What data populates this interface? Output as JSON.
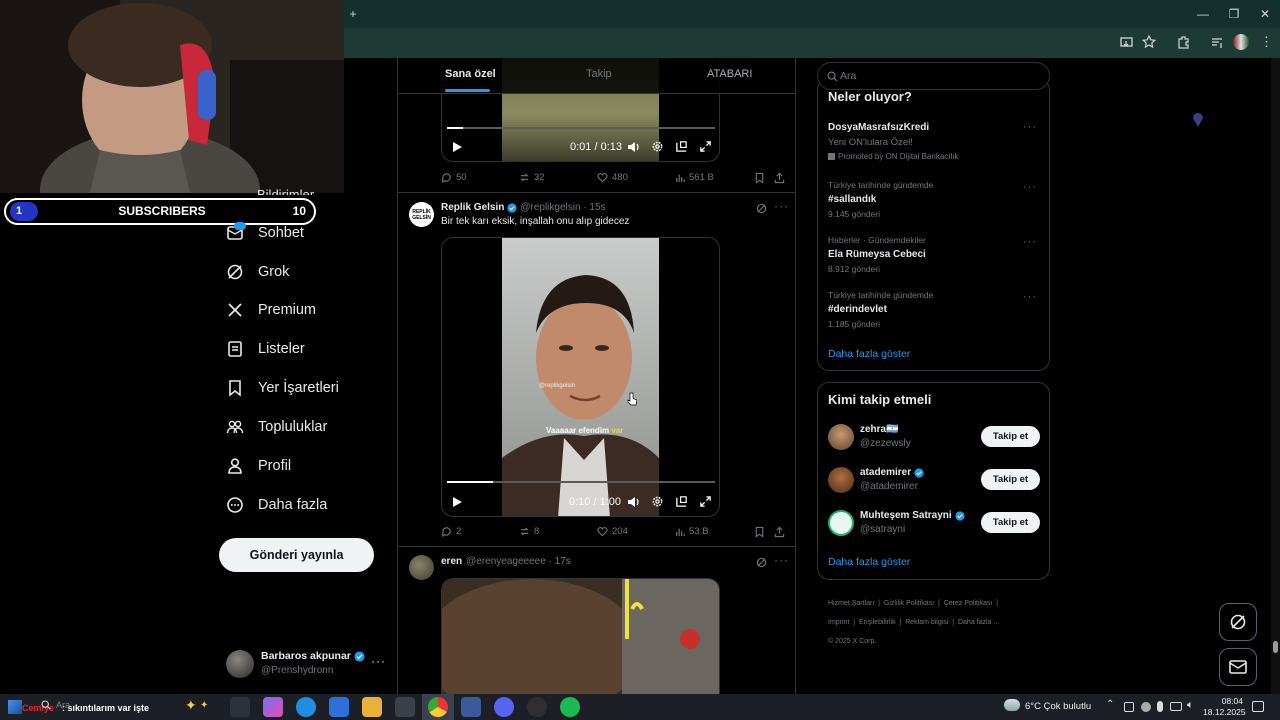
{
  "browser": {
    "new_tab": "+",
    "min": "—",
    "restore": "❐",
    "close": "✕"
  },
  "stream": {
    "subs_current": "1",
    "subs_label": "SUBSCRIBERS",
    "subs_goal": "10",
    "ticker_user": "Cemiye",
    "ticker_text": ": sıkıntılarım var işte"
  },
  "nav": {
    "partial_top": "Bildirimler",
    "items": [
      {
        "label": "Sohbet",
        "icon": "chat-icon"
      },
      {
        "label": "Grok",
        "icon": "grok-icon"
      },
      {
        "label": "Premium",
        "icon": "x-logo-icon"
      },
      {
        "label": "Listeler",
        "icon": "list-icon"
      },
      {
        "label": "Yer İşaretleri",
        "icon": "bookmark-icon"
      },
      {
        "label": "Topluluklar",
        "icon": "communities-icon"
      },
      {
        "label": "Profil",
        "icon": "profile-icon"
      },
      {
        "label": "Daha fazla",
        "icon": "more-circle-icon"
      }
    ],
    "post_button": "Gönderi yayınla",
    "account_name": "Barbaros akpunar",
    "account_handle": "@Prenshydronn"
  },
  "tabs": {
    "t1": "Sana özel",
    "t2": "Takip",
    "t3": "ATABARI"
  },
  "post0": {
    "time": "0:01 / 0:13",
    "replies": "50",
    "reposts": "32",
    "likes": "480",
    "views": "561 B"
  },
  "post1": {
    "name": "Replik Gelsin",
    "handle": "@replikgelsin · 15s",
    "text": "Bir tek karı eksik, inşallah onu alıp gidecez",
    "subtitle_1": "Vaaaaar efendim",
    "subtitle_2": "var",
    "watermark": "@replikgelsin",
    "time": "0:10 / 1:00",
    "replies": "2",
    "reposts": "8",
    "likes": "204",
    "views": "53 B",
    "progress": 0.17
  },
  "post2": {
    "name": "eren",
    "handle": "@erenyeageeeee · 17s"
  },
  "search": {
    "placeholder": "Ara"
  },
  "trends": {
    "title": "Neler oluyor?",
    "ad_name": "DosyaMasrafsızKredi",
    "ad_text": "Yeni ON'lulara Özel!",
    "ad_promo": "Promoted by ON Dijital Bankacılık",
    "items": [
      {
        "meta": "Türkiye tarihinde gündemde",
        "name": "#sallandık",
        "count": "9.145 gönderi"
      },
      {
        "meta": "Haberler · Gündemdekiler",
        "name": "Ela Rümeysa Cebeci",
        "count": "8.912 gönderi"
      },
      {
        "meta": "Türkiye tarihinde gündemde",
        "name": "#derindevlet",
        "count": "1.185 gönderi"
      }
    ],
    "show_more": "Daha fazla göster"
  },
  "who": {
    "title": "Kimi takip etmeli",
    "users": [
      {
        "name": "zehra🇦🇷",
        "handle": "@zezewsly",
        "button": "Takip et"
      },
      {
        "name": "atademirer",
        "handle": "@atademirer",
        "button": "Takip et"
      },
      {
        "name": "Muhteşem Satrayni",
        "handle": "@satrayni",
        "button": "Takip et"
      }
    ],
    "show_more": "Daha fazla göster"
  },
  "footer": {
    "l1": "Hizmet Şartları",
    "l2": "Gizlilik Politikası",
    "l3": "Çerez Politikası",
    "l4": "İmprint",
    "l5": "Erişilebilirlik",
    "l6": "Reklam bilgisi",
    "l7": "Daha fazla ...",
    "copy": "© 2025 X Corp."
  },
  "taskbar": {
    "search": "Ara",
    "weather": "6°C  Çok bulutlu",
    "time": "08:04",
    "date": "18.12.2025"
  },
  "colors": {
    "accent": "#1d9bf0",
    "browser_tab": "#14302d",
    "browser_toolbar": "#1d3a35",
    "verified": "#1d9bf0"
  }
}
